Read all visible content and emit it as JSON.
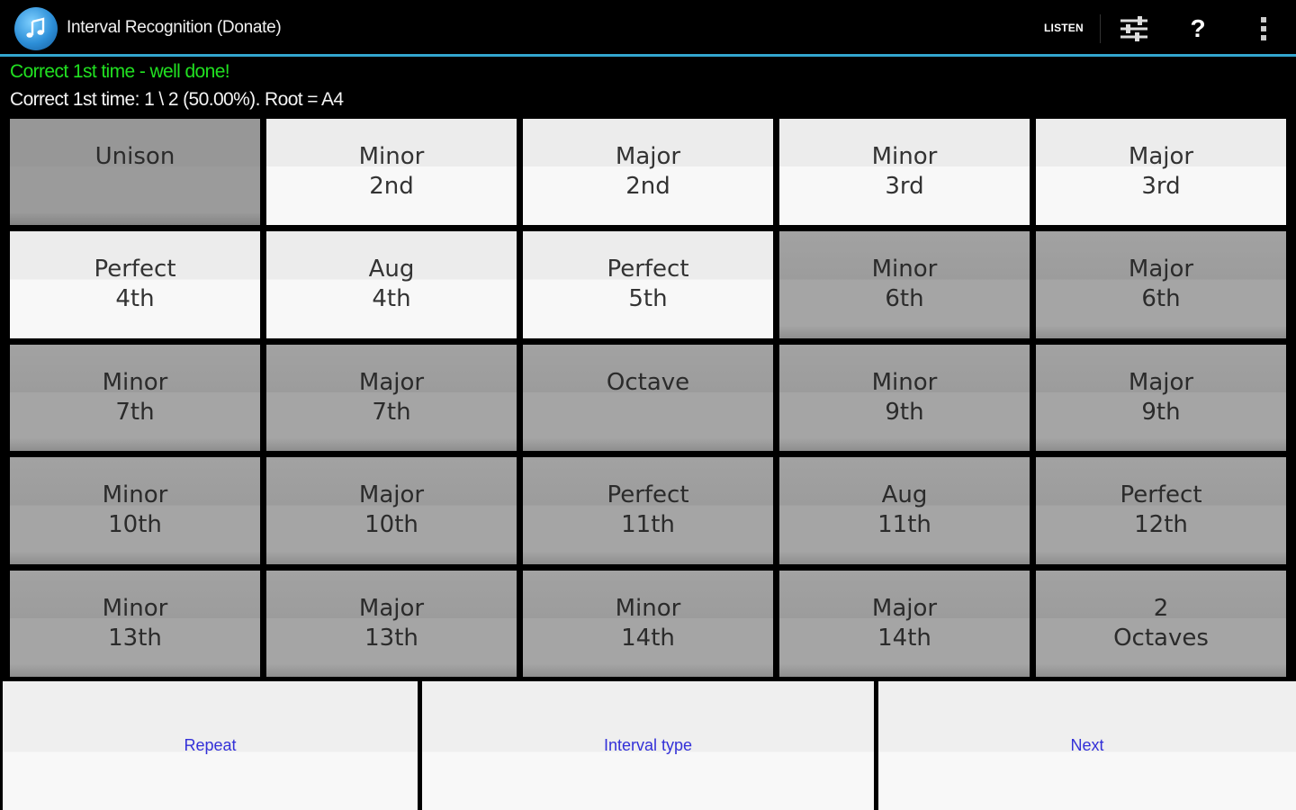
{
  "app": {
    "title": "Interval Recognition (Donate)",
    "icon": "music-note-icon",
    "actions": {
      "listen_label": "LISTEN",
      "help_label": "?"
    }
  },
  "status": {
    "message": "Correct 1st time - well done!",
    "stats": "Correct 1st time: 1 \\ 2 (50.00%).  Root = A4"
  },
  "colors": {
    "accent": "#33a6cf",
    "success": "#21e021",
    "link": "#3330d8",
    "tile_dim": "#a5a5a5",
    "tile_lit": "#f8f8f8"
  },
  "intervals": [
    {
      "line1": "Unison",
      "line2": "",
      "state": "sel"
    },
    {
      "line1": "Minor",
      "line2": "2nd",
      "state": "lit"
    },
    {
      "line1": "Major",
      "line2": "2nd",
      "state": "lit"
    },
    {
      "line1": "Minor",
      "line2": "3rd",
      "state": "lit"
    },
    {
      "line1": "Major",
      "line2": "3rd",
      "state": "lit"
    },
    {
      "line1": "Perfect",
      "line2": "4th",
      "state": "lit"
    },
    {
      "line1": "Aug",
      "line2": "4th",
      "state": "lit"
    },
    {
      "line1": "Perfect",
      "line2": "5th",
      "state": "lit"
    },
    {
      "line1": "Minor",
      "line2": "6th",
      "state": "dim"
    },
    {
      "line1": "Major",
      "line2": "6th",
      "state": "dim"
    },
    {
      "line1": "Minor",
      "line2": "7th",
      "state": "dim"
    },
    {
      "line1": "Major",
      "line2": "7th",
      "state": "dim"
    },
    {
      "line1": "Octave",
      "line2": "",
      "state": "dim"
    },
    {
      "line1": "Minor",
      "line2": "9th",
      "state": "dim"
    },
    {
      "line1": "Major",
      "line2": "9th",
      "state": "dim"
    },
    {
      "line1": "Minor",
      "line2": "10th",
      "state": "dim"
    },
    {
      "line1": "Major",
      "line2": "10th",
      "state": "dim"
    },
    {
      "line1": "Perfect",
      "line2": "11th",
      "state": "dim"
    },
    {
      "line1": "Aug",
      "line2": "11th",
      "state": "dim"
    },
    {
      "line1": "Perfect",
      "line2": "12th",
      "state": "dim"
    },
    {
      "line1": "Minor",
      "line2": "13th",
      "state": "dim"
    },
    {
      "line1": "Major",
      "line2": "13th",
      "state": "dim"
    },
    {
      "line1": "Minor",
      "line2": "14th",
      "state": "dim"
    },
    {
      "line1": "Major",
      "line2": "14th",
      "state": "dim"
    },
    {
      "line1": "2",
      "line2": "Octaves",
      "state": "dim"
    }
  ],
  "buttons": {
    "repeat": "Repeat",
    "interval_type": "Interval type",
    "next": "Next"
  }
}
